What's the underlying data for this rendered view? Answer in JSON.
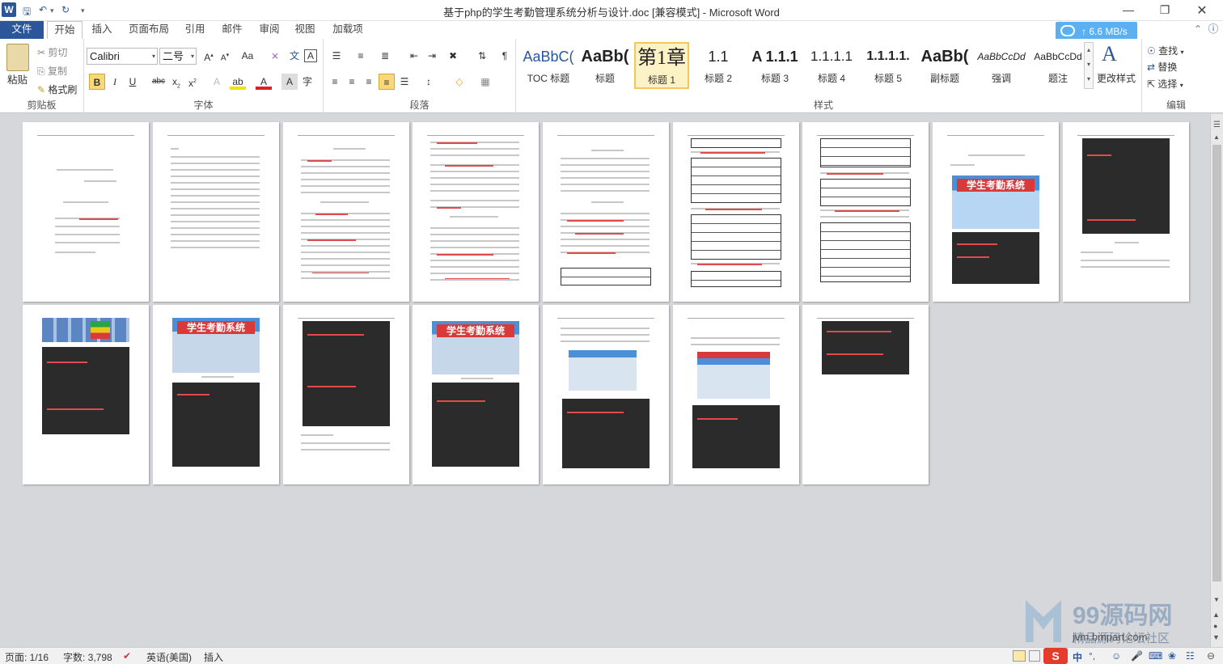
{
  "window": {
    "title": "基于php的学生考勤管理系统分析与设计.doc [兼容模式] - Microsoft Word"
  },
  "tabs": [
    {
      "label": "文件"
    },
    {
      "label": "开始"
    },
    {
      "label": "插入"
    },
    {
      "label": "页面布局"
    },
    {
      "label": "引用"
    },
    {
      "label": "邮件"
    },
    {
      "label": "审阅"
    },
    {
      "label": "视图"
    },
    {
      "label": "加载项"
    }
  ],
  "cloud_badge": {
    "speed": "6.6 MB/s"
  },
  "clipboard": {
    "paste": "粘贴",
    "cut": "剪切",
    "copy": "复制",
    "format_painter": "格式刷",
    "group_label": "剪贴板"
  },
  "font": {
    "name": "Calibri",
    "size": "二号",
    "group_label": "字体"
  },
  "paragraph": {
    "group_label": "段落"
  },
  "styles": {
    "group_label": "样式",
    "change_styles": "更改样式",
    "items": [
      {
        "preview": "AaBbC(",
        "name": "TOC 标题"
      },
      {
        "preview": "AaBb(",
        "name": "标题"
      },
      {
        "preview": "第1章",
        "name": "标题 1"
      },
      {
        "preview": "1.1",
        "name": "标题 2"
      },
      {
        "preview": "A 1.1.1",
        "name": "标题 3"
      },
      {
        "preview": "1.1.1.1",
        "name": "标题 4"
      },
      {
        "preview": "1.1.1.1.",
        "name": "标题 5"
      },
      {
        "preview": "AaBb(",
        "name": "副标题"
      },
      {
        "preview": "AaBbCcDd",
        "name": "强调"
      },
      {
        "preview": "AaBbCcDd",
        "name": "题注"
      }
    ]
  },
  "editing": {
    "find": "查找",
    "replace": "替换",
    "select": "选择",
    "group_label": "编辑"
  },
  "pages": {
    "banner_text": "学生考勤系统"
  },
  "statusbar": {
    "page": "页面: 1/16",
    "words": "字数: 3,798",
    "language": "英语(美国)",
    "mode": "插入"
  },
  "watermark": {
    "brand": "99源码网",
    "subtitle": "精品源码论坛社区",
    "url": "jvm.bmpart.com"
  }
}
